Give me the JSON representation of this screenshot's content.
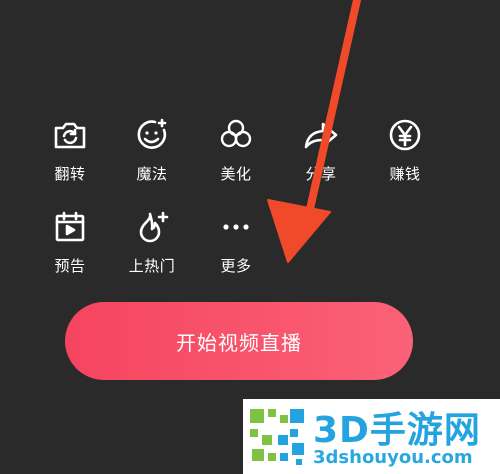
{
  "tools": [
    {
      "label": "翻转",
      "icon": "camera-flip-icon"
    },
    {
      "label": "魔法",
      "icon": "magic-face-icon"
    },
    {
      "label": "美化",
      "icon": "beautify-flower-icon"
    },
    {
      "label": "分享",
      "icon": "share-icon"
    },
    {
      "label": "赚钱",
      "icon": "yen-coin-icon"
    },
    {
      "label": "预告",
      "icon": "calendar-play-icon"
    },
    {
      "label": "上热门",
      "icon": "flame-plus-icon"
    },
    {
      "label": "更多",
      "icon": "more-dots-icon"
    }
  ],
  "start_button": {
    "label": "开始视频直播"
  },
  "watermark": {
    "title": "3D手游网",
    "url": "3dshouyou.com"
  },
  "colors": {
    "background": "#2a2a2a",
    "button_start": "#f6445f",
    "button_end": "#fa6277",
    "arrow": "#f04a2a",
    "watermark_blue": "#23a3e0",
    "watermark_green": "#7dc242"
  }
}
